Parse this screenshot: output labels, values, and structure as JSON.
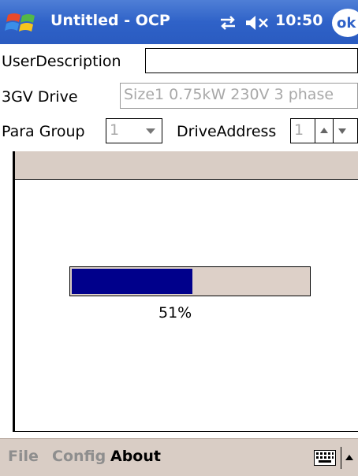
{
  "titlebar": {
    "title": "Untitled - OCP",
    "time": "10:50",
    "ok_label": "ok",
    "start_icon": "windows-flag-icon",
    "connectivity_icon": "connectivity-icon",
    "volume_icon": "speaker-muted-icon"
  },
  "form": {
    "user_description": {
      "label": "UserDescription",
      "value": ""
    },
    "drive": {
      "label": "3GV Drive",
      "value": "Size1 0.75kW 230V 3 phase"
    },
    "para_group": {
      "label": "Para Group",
      "value": "1"
    },
    "drive_address": {
      "label": "DriveAddress",
      "value": "1"
    }
  },
  "progress": {
    "percent": 51,
    "text": "51%",
    "fill_color": "#00008b"
  },
  "menubar": {
    "items": [
      "File",
      "Config",
      "About"
    ],
    "keyboard_icon": "keyboard-icon"
  },
  "colors": {
    "titlebar": "#2f62c8",
    "chrome": "#d9cdc5"
  }
}
